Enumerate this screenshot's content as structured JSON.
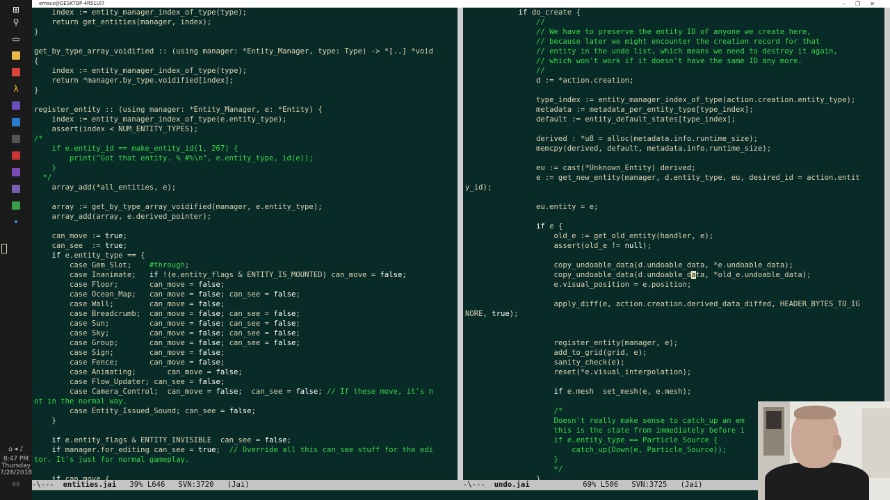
{
  "window": {
    "title": "emacs@DESKTOP-4R51UI7",
    "controls": [
      "–",
      "❐",
      "✕"
    ]
  },
  "taskbar": {
    "icons": [
      {
        "name": "windows-start",
        "glyph": "⊞",
        "color": "#ffffff"
      },
      {
        "name": "search",
        "glyph": "⚲",
        "color": "#dddddd"
      },
      {
        "name": "task-view",
        "glyph": "▭",
        "color": "#dddddd"
      },
      {
        "name": "file-explorer",
        "glyph": "",
        "color": "#e8b84a"
      },
      {
        "name": "chrome",
        "glyph": "",
        "color": "#d9453b"
      },
      {
        "name": "app-lambda",
        "glyph": "λ",
        "color": "#f0c419"
      },
      {
        "name": "app-purple",
        "glyph": "",
        "color": "#6b4fbb"
      },
      {
        "name": "app-blue",
        "glyph": "",
        "color": "#2d7bd1"
      },
      {
        "name": "obs",
        "glyph": "",
        "color": "#555555"
      },
      {
        "name": "app-red",
        "glyph": "",
        "color": "#c33"
      },
      {
        "name": "visual-studio",
        "glyph": "",
        "color": "#7b4ab5"
      },
      {
        "name": "emacs",
        "glyph": "",
        "color": "#7a5fb0"
      },
      {
        "name": "app-green",
        "glyph": "",
        "color": "#3a9b4a"
      },
      {
        "name": "app-dot",
        "glyph": "•",
        "color": "#4aa3e0"
      }
    ],
    "clock_time": "8:47 PM",
    "clock_day": "Thursday",
    "clock_date": "7/26/2018"
  },
  "left_buffer": {
    "lines": [
      [
        [
          "n",
          "    index := entity_manager_index_of_type(type);"
        ]
      ],
      [
        [
          "n",
          "    return get_entities(manager, index);"
        ]
      ],
      [
        [
          "n",
          "}"
        ]
      ],
      [
        [
          "n",
          ""
        ]
      ],
      [
        [
          "n",
          "get_by_type_array_voidified :: (using manager: *Entity_Manager, type: Type) -> *[..] *void"
        ]
      ],
      [
        [
          "n",
          "{"
        ]
      ],
      [
        [
          "n",
          "    index := entity_manager_index_of_type(type);"
        ]
      ],
      [
        [
          "n",
          "    return *manager.by_type.voidified[index];"
        ]
      ],
      [
        [
          "n",
          "}"
        ]
      ],
      [
        [
          "n",
          ""
        ]
      ],
      [
        [
          "n",
          "register_entity :: (using manager: *Entity_Manager, e: *Entity) {"
        ]
      ],
      [
        [
          "n",
          "    index := entity_manager_index_of_type(e.entity_type);"
        ]
      ],
      [
        [
          "n",
          "    assert(index < NUM_ENTITY_TYPES);"
        ]
      ],
      [
        [
          "c",
          "/*"
        ]
      ],
      [
        [
          "c",
          "    if e.entity_id == make_entity_id(1, 267) {"
        ]
      ],
      [
        [
          "c",
          "        print(\"Got that entity. % #%\\n\", e.entity_type, id(e));"
        ]
      ],
      [
        [
          "c",
          "    }"
        ]
      ],
      [
        [
          "c",
          "  */"
        ]
      ],
      [
        [
          "n",
          "    array_add(*all_entities, e);"
        ]
      ],
      [
        [
          "n",
          ""
        ]
      ],
      [
        [
          "n",
          "    array := get_by_type_array_voidified(manager, e.entity_type);"
        ]
      ],
      [
        [
          "n",
          "    array_add(array, e.derived_pointer);"
        ]
      ],
      [
        [
          "n",
          ""
        ]
      ],
      [
        [
          "n",
          "    can_move := "
        ],
        [
          "k",
          "true"
        ],
        [
          "n",
          ";"
        ]
      ],
      [
        [
          "n",
          "    can_see  := "
        ],
        [
          "k",
          "true"
        ],
        [
          "n",
          ";"
        ]
      ],
      [
        [
          "n",
          "    "
        ],
        [
          "k",
          "if"
        ],
        [
          "n",
          " e.entity_type == {"
        ]
      ],
      [
        [
          "n",
          "        case Gem_Slot;    "
        ],
        [
          "c",
          "#through"
        ],
        [
          "n",
          ";"
        ]
      ],
      [
        [
          "n",
          "        case Inanimate;   "
        ],
        [
          "k",
          "if"
        ],
        [
          "n",
          " !(e.entity_flags & ENTITY_IS_MOUNTED) can_move = "
        ],
        [
          "k",
          "false"
        ],
        [
          "n",
          ";"
        ]
      ],
      [
        [
          "n",
          "        case Floor;       can_move = "
        ],
        [
          "k",
          "false"
        ],
        [
          "n",
          ";"
        ]
      ],
      [
        [
          "n",
          "        case Ocean_Map;   can_move = "
        ],
        [
          "k",
          "false"
        ],
        [
          "n",
          "; can_see = "
        ],
        [
          "k",
          "false"
        ],
        [
          "n",
          ";"
        ]
      ],
      [
        [
          "n",
          "        case Wall;        can_move = "
        ],
        [
          "k",
          "false"
        ],
        [
          "n",
          ";"
        ]
      ],
      [
        [
          "n",
          "        case Breadcrumb;  can_move = "
        ],
        [
          "k",
          "false"
        ],
        [
          "n",
          "; can_see = "
        ],
        [
          "k",
          "false"
        ],
        [
          "n",
          ";"
        ]
      ],
      [
        [
          "n",
          "        case Sun;         can_move = "
        ],
        [
          "k",
          "false"
        ],
        [
          "n",
          "; can_see = "
        ],
        [
          "k",
          "false"
        ],
        [
          "n",
          ";"
        ]
      ],
      [
        [
          "n",
          "        case Sky;         can_move = "
        ],
        [
          "k",
          "false"
        ],
        [
          "n",
          "; can_see = "
        ],
        [
          "k",
          "false"
        ],
        [
          "n",
          ";"
        ]
      ],
      [
        [
          "n",
          "        case Group;       can_move = "
        ],
        [
          "k",
          "false"
        ],
        [
          "n",
          "; can_see = "
        ],
        [
          "k",
          "false"
        ],
        [
          "n",
          ";"
        ]
      ],
      [
        [
          "n",
          "        case Sign;        can_move = "
        ],
        [
          "k",
          "false"
        ],
        [
          "n",
          ";"
        ]
      ],
      [
        [
          "n",
          "        case Fence;       can_move = "
        ],
        [
          "k",
          "false"
        ],
        [
          "n",
          ";"
        ]
      ],
      [
        [
          "n",
          "        case Animating;       can_move = "
        ],
        [
          "k",
          "false"
        ],
        [
          "n",
          ";"
        ]
      ],
      [
        [
          "n",
          "        case Flow_Updater; can_see = "
        ],
        [
          "k",
          "false"
        ],
        [
          "n",
          ";"
        ]
      ],
      [
        [
          "n",
          "        case Camera_Control;  can_move = "
        ],
        [
          "k",
          "false"
        ],
        [
          "n",
          ";  can_see = "
        ],
        [
          "k",
          "false"
        ],
        [
          "n",
          "; "
        ],
        [
          "c",
          "// If these move, it's n"
        ]
      ],
      [
        [
          "c",
          "ot in the normal way."
        ]
      ],
      [
        [
          "n",
          "        case Entity_Issued_Sound; can_see = "
        ],
        [
          "k",
          "false"
        ],
        [
          "n",
          ";"
        ]
      ],
      [
        [
          "n",
          "    }"
        ]
      ],
      [
        [
          "n",
          ""
        ]
      ],
      [
        [
          "n",
          "    "
        ],
        [
          "k",
          "if"
        ],
        [
          "n",
          " e.entity_flags & ENTITY_INVISIBLE  can_see = "
        ],
        [
          "k",
          "false"
        ],
        [
          "n",
          ";"
        ]
      ],
      [
        [
          "n",
          "    "
        ],
        [
          "k",
          "if"
        ],
        [
          "n",
          " manager.for_editing can_see = "
        ],
        [
          "k",
          "true"
        ],
        [
          "n",
          ";  "
        ],
        [
          "c",
          "// Override all this can_see stuff for the edi"
        ]
      ],
      [
        [
          "c",
          "tor. It's just for normal gameplay."
        ]
      ],
      [
        [
          "n",
          ""
        ]
      ],
      [
        [
          "n",
          "    "
        ],
        [
          "k",
          "if"
        ],
        [
          "n",
          " can_move {"
        ]
      ]
    ]
  },
  "right_buffer": {
    "lines": [
      [
        [
          "n",
          "            "
        ],
        [
          "k",
          "if"
        ],
        [
          "n",
          " do_create {"
        ]
      ],
      [
        [
          "c",
          "                //"
        ]
      ],
      [
        [
          "c",
          "                // We have to preserve the entity ID of anyone we create here,"
        ]
      ],
      [
        [
          "c",
          "                // because later we might encounter the creation record for that"
        ]
      ],
      [
        [
          "c",
          "                // entity in the undo list, which means we need to destroy it again,"
        ]
      ],
      [
        [
          "c",
          "                // which won't work if it doesn't have the same ID any more."
        ]
      ],
      [
        [
          "c",
          "                //"
        ]
      ],
      [
        [
          "n",
          "                d := *action.creation;"
        ]
      ],
      [
        [
          "n",
          ""
        ]
      ],
      [
        [
          "n",
          "                type_index := entity_manager_index_of_type(action.creation.entity_type);"
        ]
      ],
      [
        [
          "n",
          "                metadata := metadata_per_entity_type[type_index];"
        ]
      ],
      [
        [
          "n",
          "                default := entity_default_states[type_index];"
        ]
      ],
      [
        [
          "n",
          ""
        ]
      ],
      [
        [
          "n",
          "                derived : *u8 = alloc(metadata.info.runtime_size);"
        ]
      ],
      [
        [
          "n",
          "                memcpy(derived, default, metadata.info.runtime_size);"
        ]
      ],
      [
        [
          "n",
          ""
        ]
      ],
      [
        [
          "n",
          "                eu := cast(*Unknown_Entity) derived;"
        ]
      ],
      [
        [
          "n",
          "                e := get_new_entity(manager, d.entity_type, eu, desired_id = action.entit"
        ]
      ],
      [
        [
          "n",
          "y_id);"
        ]
      ],
      [
        [
          "n",
          ""
        ]
      ],
      [
        [
          "n",
          "                eu.entity = e;"
        ]
      ],
      [
        [
          "n",
          ""
        ]
      ],
      [
        [
          "n",
          "                "
        ],
        [
          "k",
          "if"
        ],
        [
          "n",
          " e {"
        ]
      ],
      [
        [
          "n",
          "                    old_e := get_old_entity(handler, e);"
        ]
      ],
      [
        [
          "n",
          "                    assert(old_e != "
        ],
        [
          "k",
          "null"
        ],
        [
          "n",
          ");"
        ]
      ],
      [
        [
          "n",
          ""
        ]
      ],
      [
        [
          "n",
          "                    copy_undoable_data(d.undoable_data, *e.undoable_data);"
        ]
      ],
      [
        [
          "n",
          "                    copy_undoable_data(d.undoable_d"
        ],
        [
          "u",
          "a"
        ],
        [
          "n",
          "ta, *old_e.undoable_data);"
        ]
      ],
      [
        [
          "n",
          "                    e.visual_position = e.position;"
        ]
      ],
      [
        [
          "n",
          ""
        ]
      ],
      [
        [
          "n",
          "                    apply_diff(e, action.creation.derived_data_diffed, HEADER_BYTES_TO_IG"
        ]
      ],
      [
        [
          "n",
          "NORE, "
        ],
        [
          "k",
          "true"
        ],
        [
          "n",
          ");"
        ]
      ],
      [
        [
          "n",
          ""
        ]
      ],
      [
        [
          "n",
          ""
        ]
      ],
      [
        [
          "n",
          "                    register_entity(manager, e);"
        ]
      ],
      [
        [
          "n",
          "                    add_to_grid(grid, e);"
        ]
      ],
      [
        [
          "n",
          "                    sanity_check(e);"
        ]
      ],
      [
        [
          "n",
          "                    reset(*e.visual_interpolation);"
        ]
      ],
      [
        [
          "n",
          ""
        ]
      ],
      [
        [
          "n",
          "                    "
        ],
        [
          "k",
          "if"
        ],
        [
          "n",
          " e.mesh  set_mesh(e, e.mesh);"
        ]
      ],
      [
        [
          "n",
          ""
        ]
      ],
      [
        [
          "c",
          "                    /*"
        ]
      ],
      [
        [
          "c",
          "                    Doesn't really make sense to catch_up an em"
        ]
      ],
      [
        [
          "c",
          "                    this is the state from immediately before i"
        ]
      ],
      [
        [
          "c",
          "                    if e.entity_type == Particle_Source {"
        ]
      ],
      [
        [
          "c",
          "                        catch_up(Down(e, Particle_Source));"
        ]
      ],
      [
        [
          "c",
          "                    }"
        ]
      ],
      [
        [
          "c",
          "                    */"
        ]
      ],
      [
        [
          "n",
          "                }"
        ]
      ]
    ]
  },
  "modeline_left": {
    "status": "-\\---  ",
    "buffer_name": "entities.jai",
    "position": "39% L646",
    "svn": "SVN:3720",
    "mode": "(Jai)"
  },
  "modeline_right": {
    "status": "-\\---  ",
    "buffer_name": "undo.jai",
    "position": "69% L506",
    "svn": "SVN:3725",
    "mode": "(Jai)"
  }
}
